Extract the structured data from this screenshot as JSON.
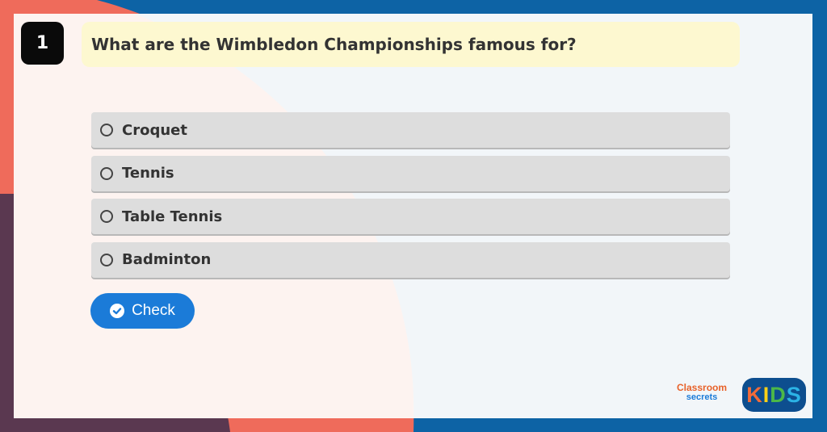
{
  "question": {
    "number": "1",
    "text": "What are the Wimbledon Championships famous for?"
  },
  "options": [
    {
      "label": "Croquet",
      "selected": false
    },
    {
      "label": "Tennis",
      "selected": false
    },
    {
      "label": "Table Tennis",
      "selected": false
    },
    {
      "label": "Badminton",
      "selected": false
    }
  ],
  "check_button": {
    "label": "Check",
    "icon": "check-circle-icon"
  },
  "branding": {
    "classroom_line1": "Classroom",
    "classroom_line2": "secrets",
    "kids_letters": [
      "K",
      "I",
      "D",
      "S"
    ],
    "kids_colors": [
      "#f26b3a",
      "#fcd116",
      "#4cb848",
      "#2bb3e6"
    ]
  },
  "colors": {
    "frame_blue": "#0d63a5",
    "accent_coral": "#ef6b5b",
    "dark_plum": "#5a3850",
    "button_blue": "#1b7bd8",
    "question_bg": "#fdf8d0"
  }
}
